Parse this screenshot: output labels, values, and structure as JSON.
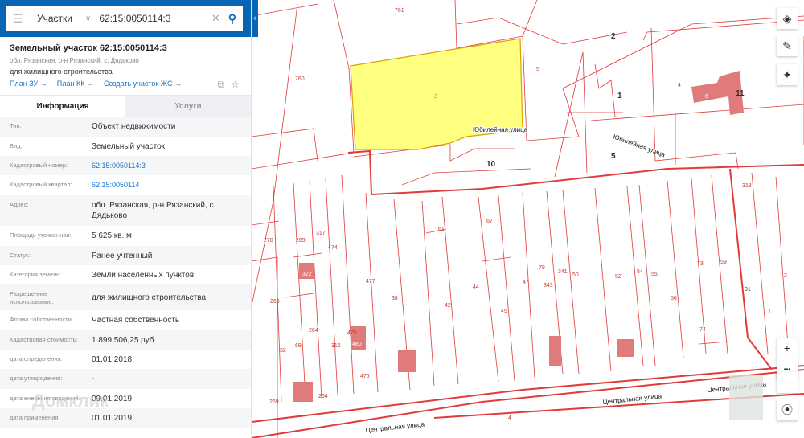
{
  "search": {
    "category": "Участки",
    "query": "62:15:0050114:3"
  },
  "parcel": {
    "title": "Земельный участок 62:15:0050114:3",
    "address": "обл. Рязанская, р-н Рязанский, с. Дядьково",
    "use": "для жилищного строительства",
    "links": [
      "План ЗУ →",
      "План КК →",
      "Создать участок ЖС →"
    ]
  },
  "tabs": [
    "Информация",
    "Услуги"
  ],
  "info": [
    {
      "k": "Тип:",
      "v": "Объект недвижимости"
    },
    {
      "k": "Вид:",
      "v": "Земельный участок"
    },
    {
      "k": "Кадастровый номер:",
      "v": "62:15:0050114:3"
    },
    {
      "k": "Кадастровый квартал:",
      "v": "62:15:0050114"
    },
    {
      "k": "Адрес:",
      "v": "обл. Рязанская, р-н Рязанский, с. Дядьково"
    },
    {
      "k": "Площадь уточненная:",
      "v": "5 625 кв. м"
    },
    {
      "k": "Статус:",
      "v": "Ранее учтенный"
    },
    {
      "k": "Категория земель:",
      "v": "Земли населённых пунктов"
    },
    {
      "k": "Разрешенное использование:",
      "v": "для жилищного строительства"
    },
    {
      "k": "Форма собственности:",
      "v": "Частная собственность"
    },
    {
      "k": "Кадастровая стоимость:",
      "v": "1 899 506,25 руб."
    },
    {
      "k": "дата определения:",
      "v": "01.01.2018"
    },
    {
      "k": "дата утверждения:",
      "v": "-"
    },
    {
      "k": "дата внесения сведений:",
      "v": "09.01.2019"
    },
    {
      "k": "дата применения:",
      "v": "01.01.2019"
    }
  ],
  "watermark": "Домклик",
  "map": {
    "highlight_color": "#ffff80",
    "streets": [
      "Юбилейная улица",
      "Юбилейная улица",
      "Центральная улица",
      "Центральная улица",
      "Центральная улица"
    ],
    "labels": [
      "761",
      "760",
      "3",
      "5",
      "2",
      "1",
      "4",
      "6",
      "11",
      "10",
      "5",
      "318",
      "270",
      "265",
      "317",
      "474",
      "477",
      "38",
      "61",
      "67",
      "44",
      "42",
      "45",
      "47",
      "79",
      "343",
      "341",
      "50",
      "52",
      "54",
      "55",
      "56",
      "73",
      "59",
      "74",
      "2",
      "1",
      "91",
      "269",
      "32",
      "69",
      "264",
      "316",
      "475",
      "480",
      "476",
      "322",
      "264",
      "269",
      "4"
    ]
  },
  "controls": {
    "zoom_in": "+",
    "zoom_out": "−",
    "more": "•••"
  }
}
